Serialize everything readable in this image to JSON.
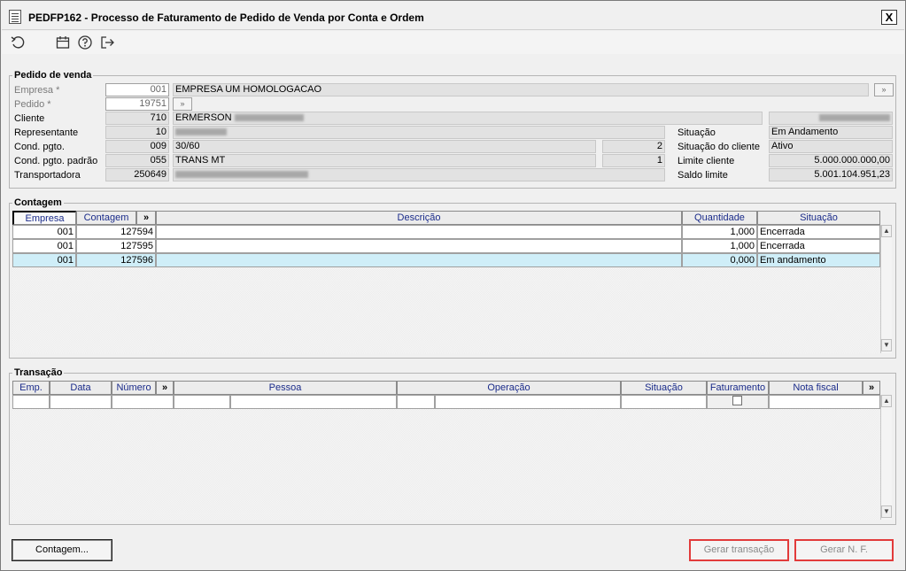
{
  "window": {
    "title": "PEDFP162 - Processo de Faturamento de Pedido de Venda por Conta e Ordem",
    "close_label": "X"
  },
  "toolbar": {
    "icons": [
      "undo-icon",
      "calendar-icon",
      "help-icon",
      "exit-icon"
    ]
  },
  "pedido": {
    "group_title": "Pedido de venda",
    "empresa_label": "Empresa *",
    "empresa_code": "001",
    "empresa_name": "EMPRESA UM HOMOLOGACAO",
    "pedido_label": "Pedido *",
    "pedido_value": "19751",
    "cliente_label": "Cliente",
    "cliente_code": "710",
    "cliente_name": "ERMERSON",
    "representante_label": "Representante",
    "representante_code": "10",
    "cond_pgto_label": "Cond. pgto.",
    "cond_pgto_code": "009",
    "cond_pgto_desc": "30/60",
    "cond_pgto_qty": "2",
    "cond_padrao_label": "Cond. pgto. padrão",
    "cond_padrao_code": "055",
    "cond_padrao_desc": "TRANS MT",
    "cond_padrao_qty": "1",
    "transportadora_label": "Transportadora",
    "transportadora_code": "250649",
    "situacao_label": "Situação",
    "situacao_value": "Em Andamento",
    "situacao_cliente_label": "Situação do cliente",
    "situacao_cliente_value": "Ativo",
    "limite_label": "Limite cliente",
    "limite_value": "5.000.000.000,00",
    "saldo_label": "Saldo limite",
    "saldo_value": "5.001.104.951,23"
  },
  "contagem": {
    "group_title": "Contagem",
    "columns": [
      "Empresa",
      "Contagem",
      "»",
      "Descrição",
      "Quantidade",
      "Situação"
    ],
    "rows": [
      {
        "empresa": "001",
        "contagem": "127594",
        "descricao": "",
        "quantidade": "1,000",
        "situacao": "Encerrada"
      },
      {
        "empresa": "001",
        "contagem": "127595",
        "descricao": "",
        "quantidade": "1,000",
        "situacao": "Encerrada"
      },
      {
        "empresa": "001",
        "contagem": "127596",
        "descricao": "",
        "quantidade": "0,000",
        "situacao": "Em andamento"
      }
    ]
  },
  "transacao": {
    "group_title": "Transação",
    "columns": [
      "Emp.",
      "Data",
      "Número",
      "»",
      "Pessoa",
      "Operação",
      "Situação",
      "Faturamento",
      "Nota fiscal",
      "»"
    ]
  },
  "buttons": {
    "contagem": "Contagem...",
    "gerar_transacao": "Gerar transação",
    "gerar_nf": "Gerar N. F."
  }
}
